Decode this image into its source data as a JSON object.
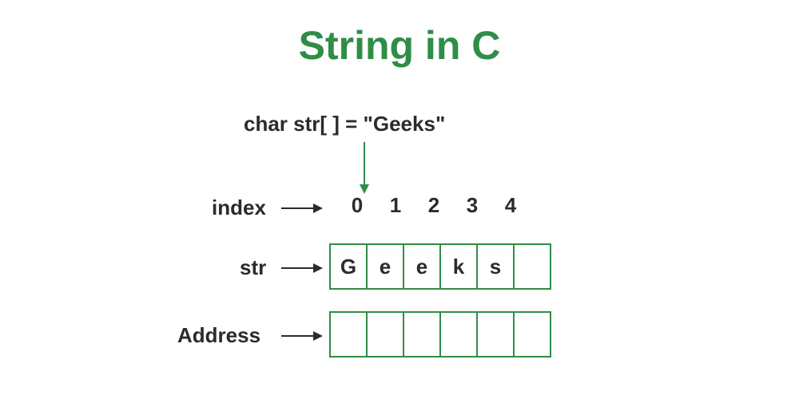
{
  "title": "String in C",
  "declaration": "char str[ ] = \"Geeks\"",
  "labels": {
    "index": "index",
    "str": "str",
    "address": "Address"
  },
  "chart_data": {
    "type": "table",
    "indices": [
      "0",
      "1",
      "2",
      "3",
      "4"
    ],
    "chars": [
      "G",
      "e",
      "e",
      "k",
      "s",
      ""
    ],
    "addresses": [
      "",
      "",
      "",
      "",
      "",
      ""
    ]
  }
}
